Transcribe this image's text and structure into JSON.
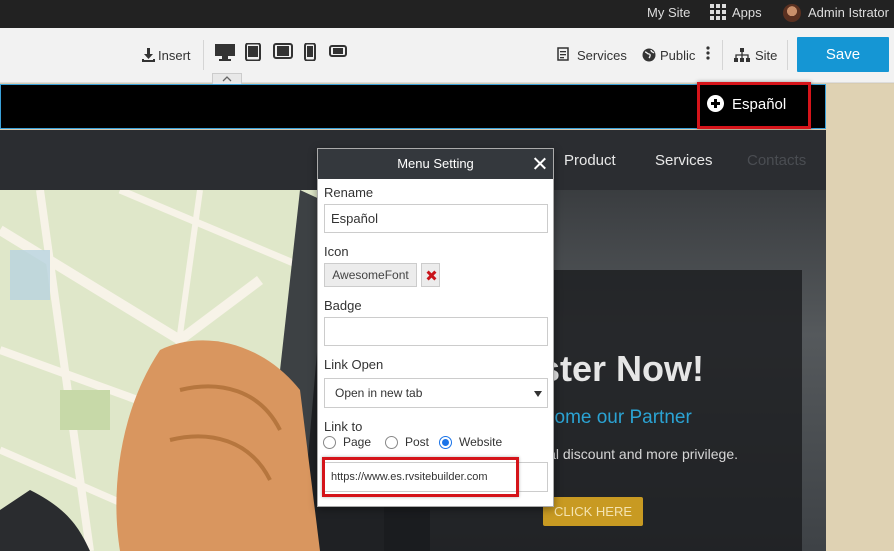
{
  "topbar": {
    "my_site": "My Site",
    "apps": "Apps",
    "user": "Admin Istrator"
  },
  "toolbar": {
    "insert": "Insert",
    "services": "Services",
    "public": "Public",
    "site": "Site",
    "save": "Save"
  },
  "language": {
    "label": "Español"
  },
  "nav": {
    "items": [
      "Product",
      "Services",
      "Contacts"
    ]
  },
  "hero": {
    "title": "ster Now!",
    "subtitle": "come our Partner",
    "text": "ial discount and more privilege.",
    "cta": "CLICK HERE"
  },
  "modal": {
    "title": "Menu Setting",
    "rename_label": "Rename",
    "rename_value": "Español",
    "icon_label": "Icon",
    "icon_value": "AwesomeFont",
    "badge_label": "Badge",
    "badge_value": "",
    "link_open_label": "Link Open",
    "link_open_value": "Open in new tab",
    "link_to_label": "Link to",
    "link_options": [
      "Page",
      "Post",
      "Website"
    ],
    "selected_link": "Website",
    "url_value": "https://www.es.rvsitebuilder.com"
  },
  "colors": {
    "accent": "#1596d4",
    "highlight": "#d5141a",
    "hero_sub": "#2ba3d3",
    "cta": "#c89a22"
  }
}
